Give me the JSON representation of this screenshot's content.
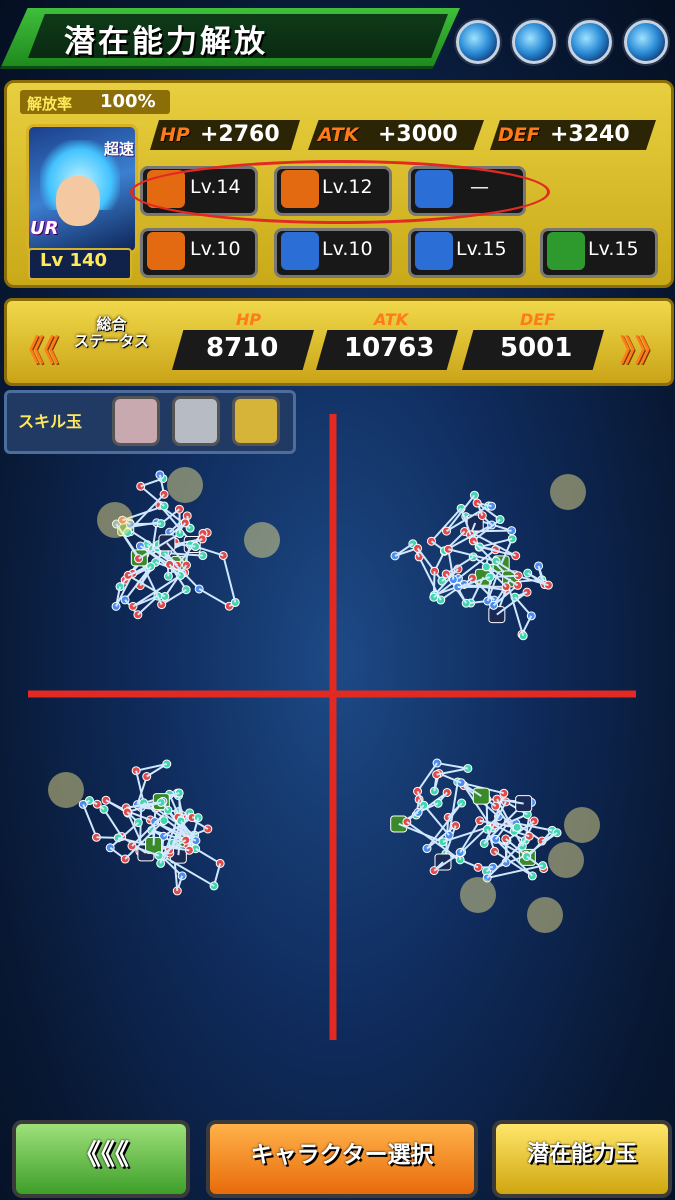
{
  "header": {
    "title": "潜在能力解放",
    "orb_count": 4
  },
  "character": {
    "release_rate_label": "解放率",
    "release_rate": "100%",
    "type_label": "超速",
    "rarity": "UR",
    "level": "Lv 140",
    "stats": [
      {
        "key": "HP",
        "value": "+2760"
      },
      {
        "key": "ATK",
        "value": "+3000"
      },
      {
        "key": "DEF",
        "value": "+3240"
      }
    ],
    "skills_row1": [
      {
        "icon": "punch-icon",
        "level": "Lv.14",
        "color": "#e46a12"
      },
      {
        "icon": "fist-icon",
        "level": "Lv.12",
        "color": "#e46a12"
      },
      {
        "icon": "dash-icon",
        "level": "—",
        "color": "#2b6fd6"
      }
    ],
    "skills_row2": [
      {
        "icon": "character-icon",
        "level": "Lv.10",
        "color": "#e46a12"
      },
      {
        "icon": "character-icon",
        "level": "Lv.10",
        "color": "#2b6fd6"
      },
      {
        "icon": "energy-burst-icon",
        "level": "Lv.15",
        "color": "#2b6fd6"
      },
      {
        "icon": "green-shield-icon",
        "level": "Lv.15",
        "color": "#2e9a2e"
      }
    ]
  },
  "total_status": {
    "label_line1": "総合",
    "label_line2": "ステータス",
    "left_arrow": "《《",
    "right_arrow": "》》",
    "values": [
      {
        "key": "HP",
        "value": "8710"
      },
      {
        "key": "ATK",
        "value": "10763"
      },
      {
        "key": "DEF",
        "value": "5001"
      }
    ]
  },
  "skill_orbs": {
    "label": "スキル玉",
    "slots": [
      {
        "name": "rainbow",
        "color": "#c9a9b0"
      },
      {
        "name": "silver",
        "color": "#b7bcc4"
      },
      {
        "name": "gold",
        "color": "#d6b43a"
      }
    ]
  },
  "buttons": {
    "back": "《《《",
    "character_select": "キャラクター選択",
    "potential_orbs": "潜在能力玉"
  },
  "colors": {
    "accent_green": "#2fa82c",
    "panel_gold": "#d8bd2c",
    "red_mark": "#e22a22"
  }
}
